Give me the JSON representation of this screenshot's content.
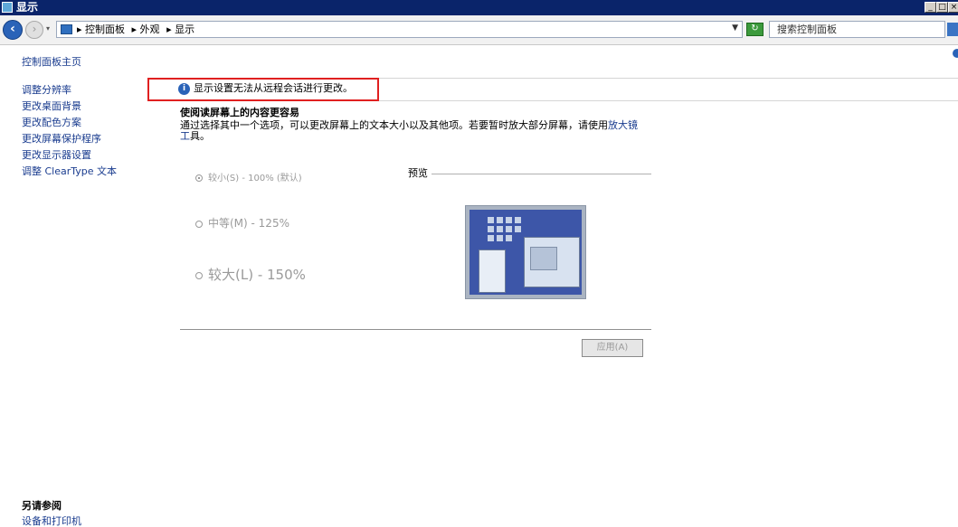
{
  "window": {
    "title": "显示",
    "buttons": [
      "_",
      "□",
      "×"
    ]
  },
  "address_bar": {
    "breadcrumbs": [
      "▸ 控制面板",
      "▸ 外观",
      "▸ 显示"
    ],
    "search_placeholder": "搜索控制面板"
  },
  "sidebar": {
    "home": "控制面板主页",
    "items": [
      "调整分辨率",
      "更改桌面背景",
      "更改配色方案",
      "更改屏幕保护程序",
      "更改显示器设置",
      "调整 ClearType 文本"
    ],
    "see_also_title": "另请参阅",
    "see_also_items": [
      "设备和打印机"
    ]
  },
  "info": {
    "message": "显示设置无法从远程会话进行更改。",
    "highlight_color": "#e02020"
  },
  "main": {
    "heading": "使阅读屏幕上的内容更容易",
    "description_prefix": "通过选择其中一个选项，可以更改屏幕上的文本大小以及其他项。若要暂时放大部分屏幕，请使用",
    "description_link": "放大镜工",
    "description_suffix": "具。",
    "options": [
      {
        "label": "较小(S) - 100% (默认)",
        "selected": true
      },
      {
        "label": "中等(M) - 125%",
        "selected": false
      },
      {
        "label": "较大(L) - 150%",
        "selected": false
      }
    ],
    "preview_label": "预览",
    "apply_button": "应用(A)"
  }
}
